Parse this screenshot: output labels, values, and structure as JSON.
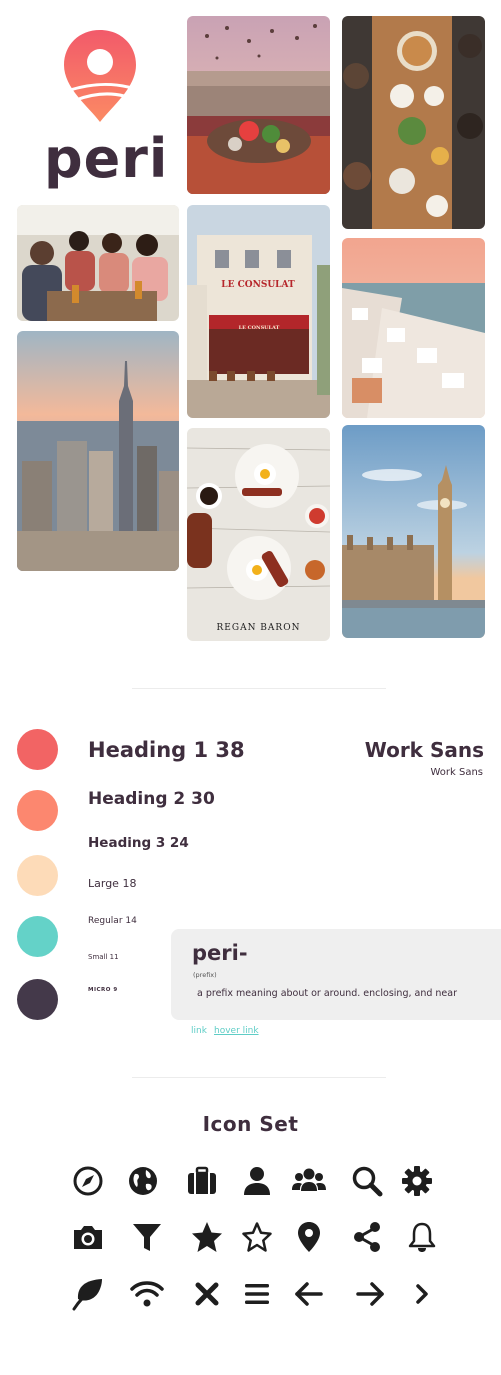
{
  "brand": {
    "wordmark": "peri",
    "logo_icon": "map-pin-logo"
  },
  "photos": {
    "cafe_sign": "LE CONSULAT",
    "cafe_awning": "LE CONSULAT",
    "breakfast_credit": "REGAN BARON"
  },
  "palette": [
    "#f26464",
    "#fc876f",
    "#fddbb8",
    "#64d2c8",
    "#44394a"
  ],
  "typography": {
    "heading1": "Heading 1 38",
    "heading2": "Heading 2 30",
    "heading3": "Heading 3 24",
    "large": "Large 18",
    "regular": "Regular 14",
    "small": "Small 11",
    "micro": "MICRO 9",
    "font_name": "Work Sans",
    "font_name_sub": "Work Sans"
  },
  "definition": {
    "word": "peri-",
    "part_of_speech": "(prefix)",
    "text": "a prefix meaning about or around. enclosing, and near"
  },
  "links": {
    "link": "link",
    "hover_link": "hover link"
  },
  "icon_set": {
    "title": "Icon Set",
    "icons": [
      "compass-icon",
      "globe-icon",
      "suitcase-icon",
      "user-icon",
      "users-icon",
      "search-icon",
      "gear-icon",
      "camera-icon",
      "filter-icon",
      "star-filled-icon",
      "star-outline-icon",
      "map-pin-icon",
      "share-icon",
      "bell-icon",
      "leaf-icon",
      "wifi-icon",
      "close-icon",
      "menu-icon",
      "arrow-left-icon",
      "arrow-right-icon",
      "chevron-right-icon"
    ]
  }
}
